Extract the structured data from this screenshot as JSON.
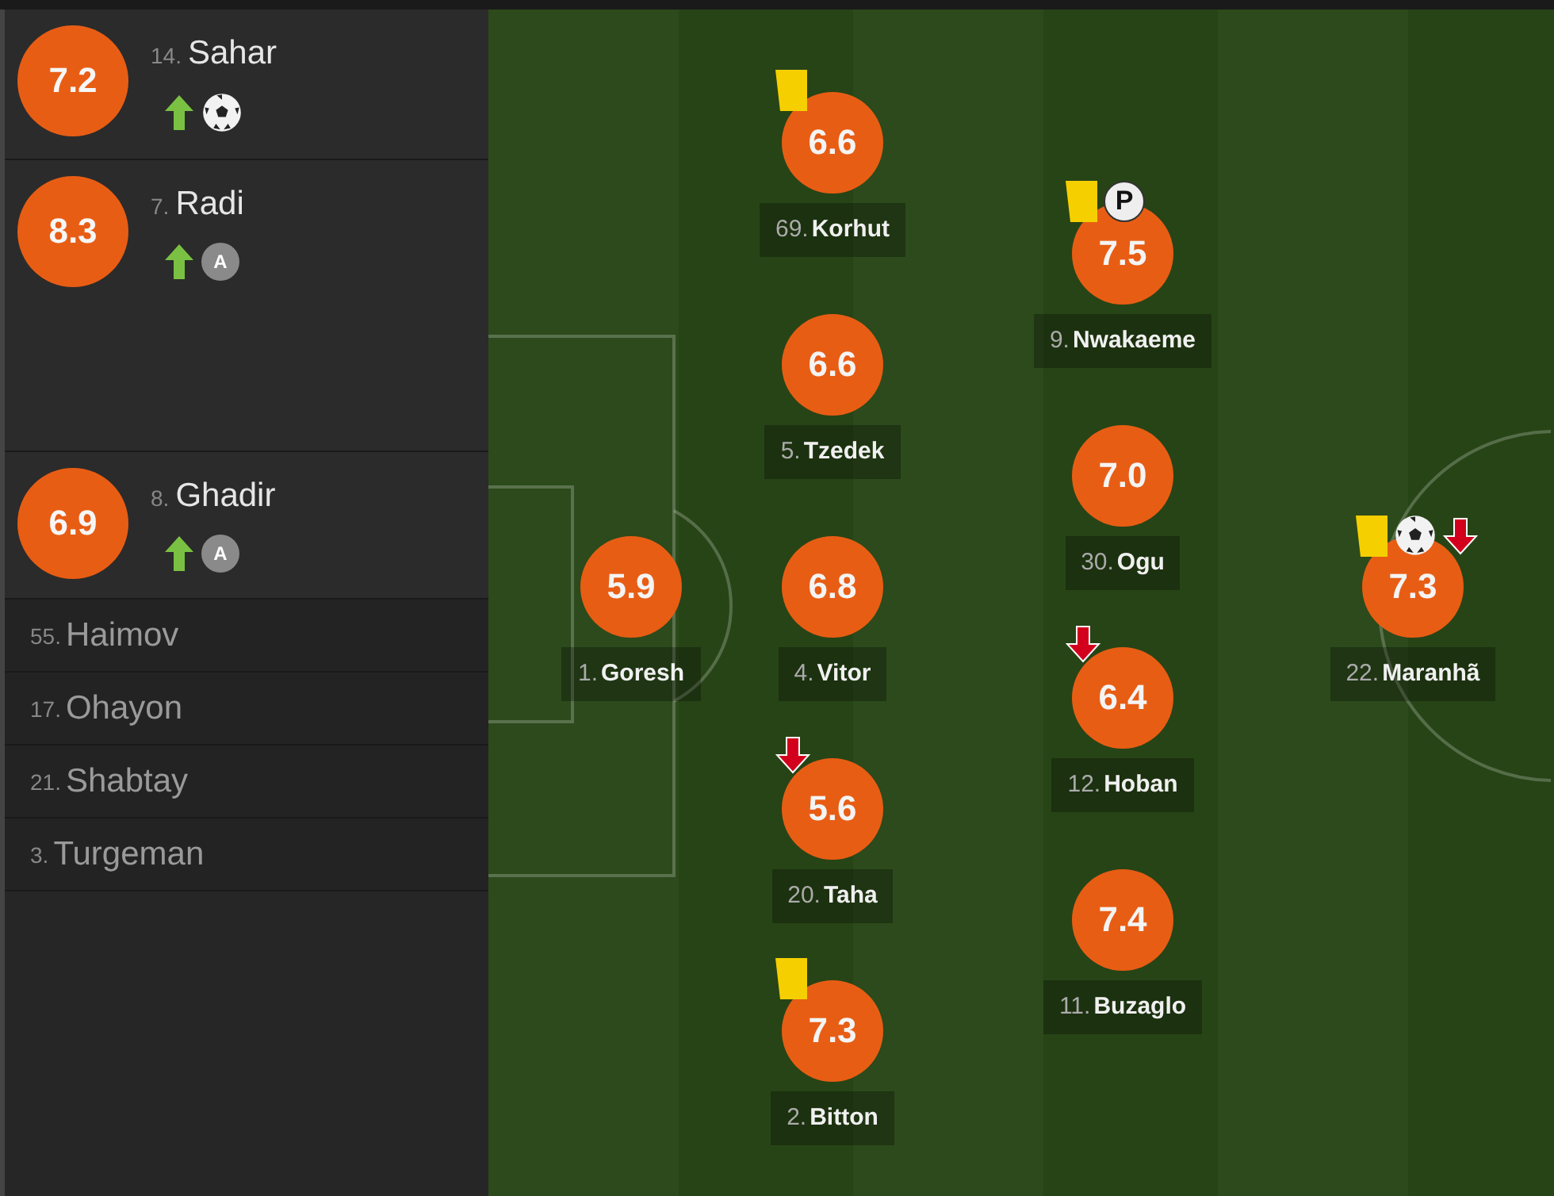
{
  "substitutes": [
    {
      "kind": "rated",
      "rating": "7.2",
      "number": "14.",
      "name": "Sahar",
      "events": [
        {
          "kind": "sub_in"
        },
        {
          "kind": "goal"
        }
      ]
    },
    {
      "kind": "rated",
      "rating": "8.3",
      "number": "7.",
      "name": "Radi",
      "events": [
        {
          "kind": "sub_in"
        },
        {
          "kind": "assist",
          "mark": "A"
        }
      ]
    },
    {
      "kind": "rated",
      "rating": "6.9",
      "number": "8.",
      "name": "Ghadir",
      "events": [
        {
          "kind": "sub_in"
        },
        {
          "kind": "assist",
          "mark": "A"
        }
      ]
    },
    {
      "kind": "plain",
      "number": "55.",
      "name": "Haimov"
    },
    {
      "kind": "plain",
      "number": "17.",
      "name": "Ohayon"
    },
    {
      "kind": "plain",
      "number": "21.",
      "name": "Shabtay"
    },
    {
      "kind": "plain",
      "number": "3.",
      "name": "Turgeman"
    }
  ],
  "pitch": {
    "lines": [
      {
        "players": [
          {
            "rating": "5.9",
            "number": "1.",
            "name": "Goresh"
          }
        ]
      },
      {
        "players": [
          {
            "rating": "6.6",
            "number": "69.",
            "name": "Korhut",
            "events": [
              {
                "kind": "yellow_card"
              }
            ]
          },
          {
            "rating": "6.6",
            "number": "5.",
            "name": "Tzedek"
          },
          {
            "rating": "6.8",
            "number": "4.",
            "name": "Vitor"
          },
          {
            "rating": "5.6",
            "number": "20.",
            "name": "Taha",
            "events": [
              {
                "kind": "sub_out"
              }
            ]
          },
          {
            "rating": "7.3",
            "number": "2.",
            "name": "Bitton",
            "events": [
              {
                "kind": "yellow_card"
              }
            ]
          }
        ]
      },
      {
        "players": [
          {
            "rating": "7.5",
            "number": "9.",
            "name": "Nwakaeme",
            "events": [
              {
                "kind": "yellow_card"
              },
              {
                "kind": "penalty_goal",
                "mark": "P"
              }
            ]
          },
          {
            "rating": "7.0",
            "number": "30.",
            "name": "Ogu"
          },
          {
            "rating": "6.4",
            "number": "12.",
            "name": "Hoban",
            "events": [
              {
                "kind": "sub_out"
              }
            ]
          },
          {
            "rating": "7.4",
            "number": "11.",
            "name": "Buzaglo"
          }
        ]
      },
      {
        "players": [
          {
            "rating": "7.3",
            "number": "22.",
            "name": "Maranhã",
            "events": [
              {
                "kind": "yellow_card"
              },
              {
                "kind": "goal"
              },
              {
                "kind": "sub_out"
              }
            ]
          }
        ]
      }
    ]
  }
}
